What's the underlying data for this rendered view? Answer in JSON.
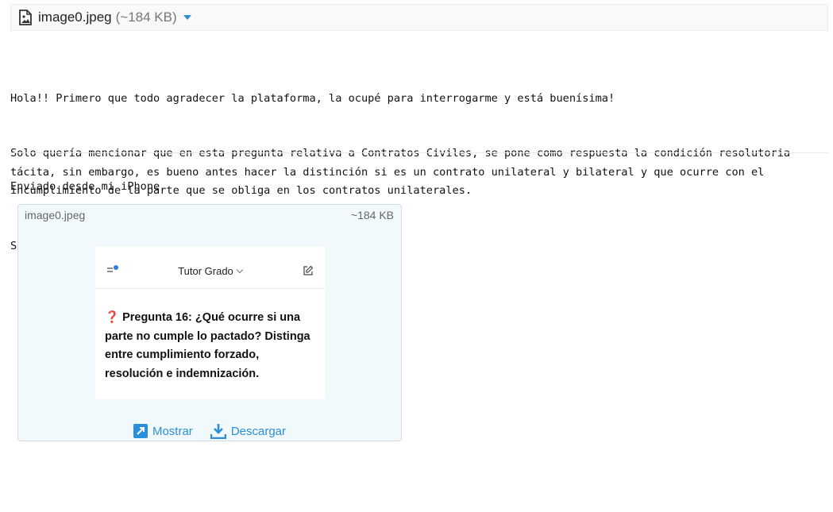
{
  "attachment": {
    "filename": "image0.jpeg",
    "size_label": "(~184 KB)",
    "file_icon": "image-file-icon",
    "menu_icon": "caret-down-icon"
  },
  "message": {
    "lines": [
      "Hola!! Primero que todo agradecer la plataforma, la ocupé para interrogarme y está buenísima!",
      "Solo quería mencionar que en esta pregunta relativa a Contratos Civiles, se pone como respuesta la condición resolutoria tácita, sin embargo, es bueno antes hacer la distinción si es un contrato unilateral y bilateral y que ocurre con el incumplimiento de la parte que se obliga en los contratos unilaterales.",
      "Solo esooo! Saludos!!"
    ],
    "signature": "Enviado desde mi iPhone"
  },
  "preview_card": {
    "filename": "image0.jpeg",
    "size_label": "~184 KB",
    "thumbnail": {
      "app_title": "Tutor Grado",
      "question_mark": "❓",
      "question_label": "Pregunta 16:",
      "question_text": " ¿Qué ocurre si una parte no cumple lo pactado? Distinga entre cumplimiento forzado, resolución e indemnización."
    },
    "actions": {
      "show_label": "Mostrar",
      "download_label": "Descargar"
    }
  },
  "colors": {
    "accent": "#2a8fd8",
    "card_bg": "#f2f9fd",
    "question_mark": "#d62020"
  }
}
